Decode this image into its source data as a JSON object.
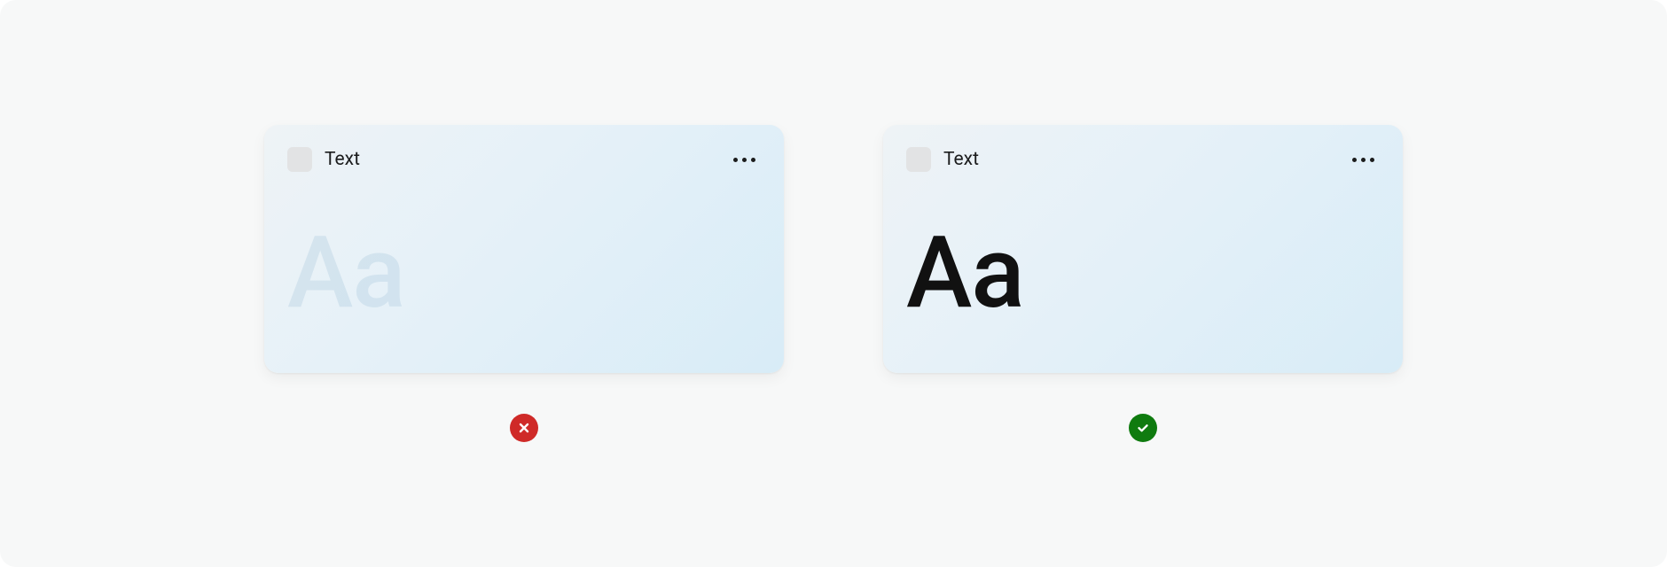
{
  "examples": {
    "fail": {
      "card_title": "Text",
      "sample_text": "Aa",
      "status": "fail"
    },
    "pass": {
      "card_title": "Text",
      "sample_text": "Aa",
      "status": "pass"
    }
  },
  "colors": {
    "fail_badge": "#cf2a28",
    "pass_badge": "#0f7b0f",
    "canvas_bg": "#f7f8f8"
  }
}
